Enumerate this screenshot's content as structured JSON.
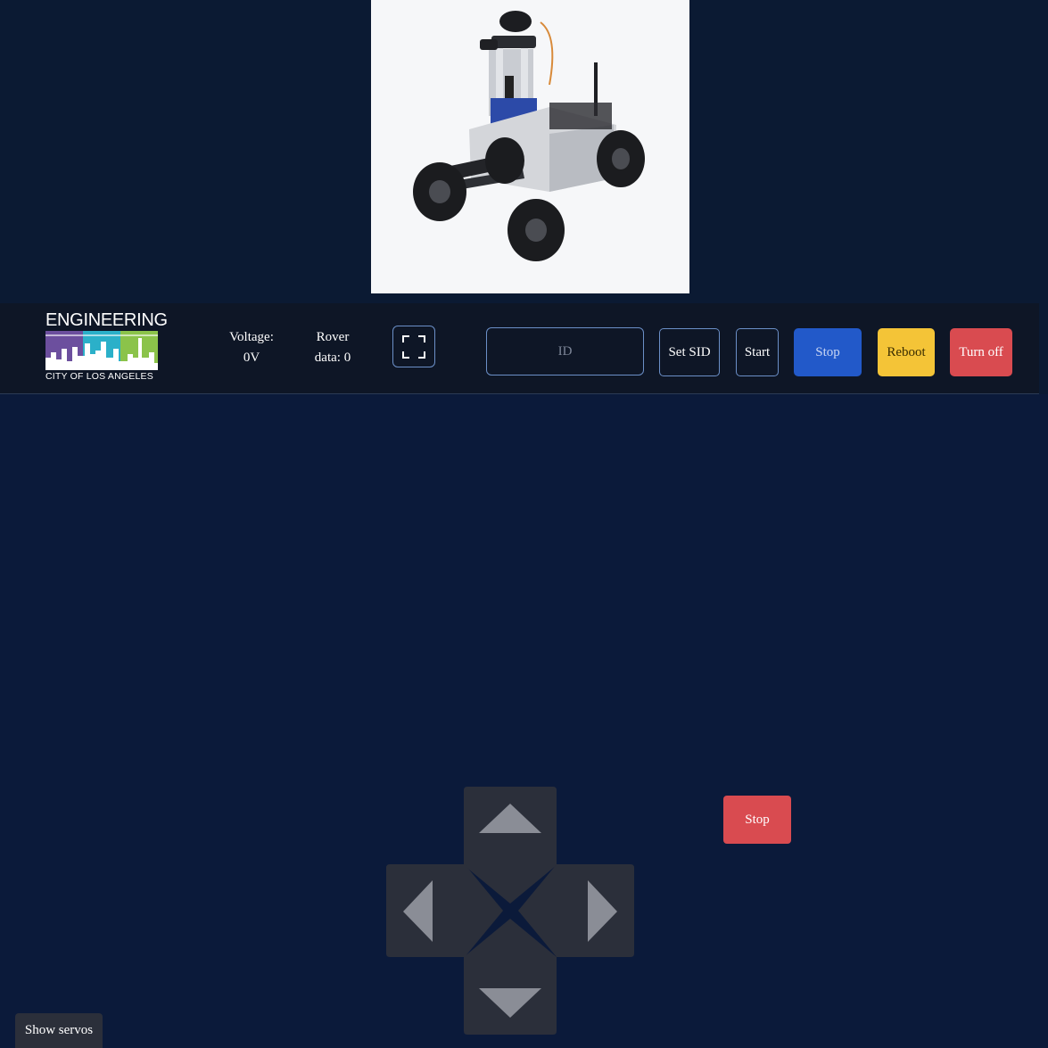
{
  "rover_image": {
    "icon": "rover-robot-photo"
  },
  "header": {
    "logo": {
      "title": "ENGINEERING",
      "subtitle": "CITY OF LOS ANGELES",
      "colors": [
        "#6c4f9e",
        "#2bb0c9",
        "#8bc34a"
      ]
    },
    "voltage": {
      "label": "Voltage:",
      "value": "0V"
    },
    "rover_data": {
      "label": "Rover",
      "value": "data: 0"
    },
    "fullscreen": {
      "icon": "fullscreen-icon"
    },
    "id_input": {
      "placeholder": "ID",
      "value": ""
    },
    "buttons": {
      "set_sid": "Set SID",
      "start": "Start",
      "stop": "Stop",
      "reboot": "Reboot",
      "turn_off": "Turn off"
    }
  },
  "controls": {
    "dpad": {
      "up_icon": "arrow-up-icon",
      "down_icon": "arrow-down-icon",
      "left_icon": "arrow-left-icon",
      "right_icon": "arrow-right-icon"
    },
    "stop": "Stop",
    "show_servos": "Show servos"
  },
  "colors": {
    "background": "#0b1a3a",
    "header_bg": "#0e1626",
    "stop_blue": "#2259c9",
    "reboot_yellow": "#f4c437",
    "danger_red": "#d94b50",
    "dpad_gray": "#2b2f3a"
  }
}
